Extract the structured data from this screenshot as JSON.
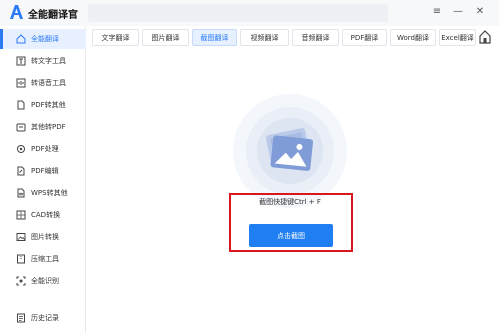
{
  "app": {
    "title": "全能翻译官",
    "brand_color": "#2b7bf5"
  },
  "window_controls": {
    "menu": "≡",
    "minimize": "—",
    "close": "✕"
  },
  "sidebar": {
    "items": [
      {
        "label": "全能翻译",
        "icon": "home-icon",
        "active": true
      },
      {
        "label": "转文字工具",
        "icon": "text-convert-icon"
      },
      {
        "label": "转语音工具",
        "icon": "voice-icon"
      },
      {
        "label": "PDF转其他",
        "icon": "pdf-export-icon"
      },
      {
        "label": "其他转PDF",
        "icon": "pdf-import-icon"
      },
      {
        "label": "PDF处理",
        "icon": "pdf-process-icon"
      },
      {
        "label": "PDF编辑",
        "icon": "pdf-edit-icon"
      },
      {
        "label": "WPS转其他",
        "icon": "wps-icon"
      },
      {
        "label": "CAD转换",
        "icon": "cad-icon"
      },
      {
        "label": "图片转换",
        "icon": "image-icon"
      },
      {
        "label": "压缩工具",
        "icon": "compress-icon"
      },
      {
        "label": "全能识别",
        "icon": "scan-icon"
      },
      {
        "label": "历史记录",
        "icon": "history-icon"
      }
    ]
  },
  "tabs": [
    {
      "label": "文字翻译"
    },
    {
      "label": "图片翻译"
    },
    {
      "label": "截图翻译",
      "active": true
    },
    {
      "label": "视频翻译"
    },
    {
      "label": "音频翻译"
    },
    {
      "label": "PDF翻译"
    },
    {
      "label": "Word翻译"
    },
    {
      "label": "Excel翻译"
    }
  ],
  "main": {
    "hint": "截图快捷键Ctrl + F",
    "capture_button": "点击截图",
    "illustration_icon": "image-placeholder-icon",
    "highlight_color": "#d9161c"
  }
}
